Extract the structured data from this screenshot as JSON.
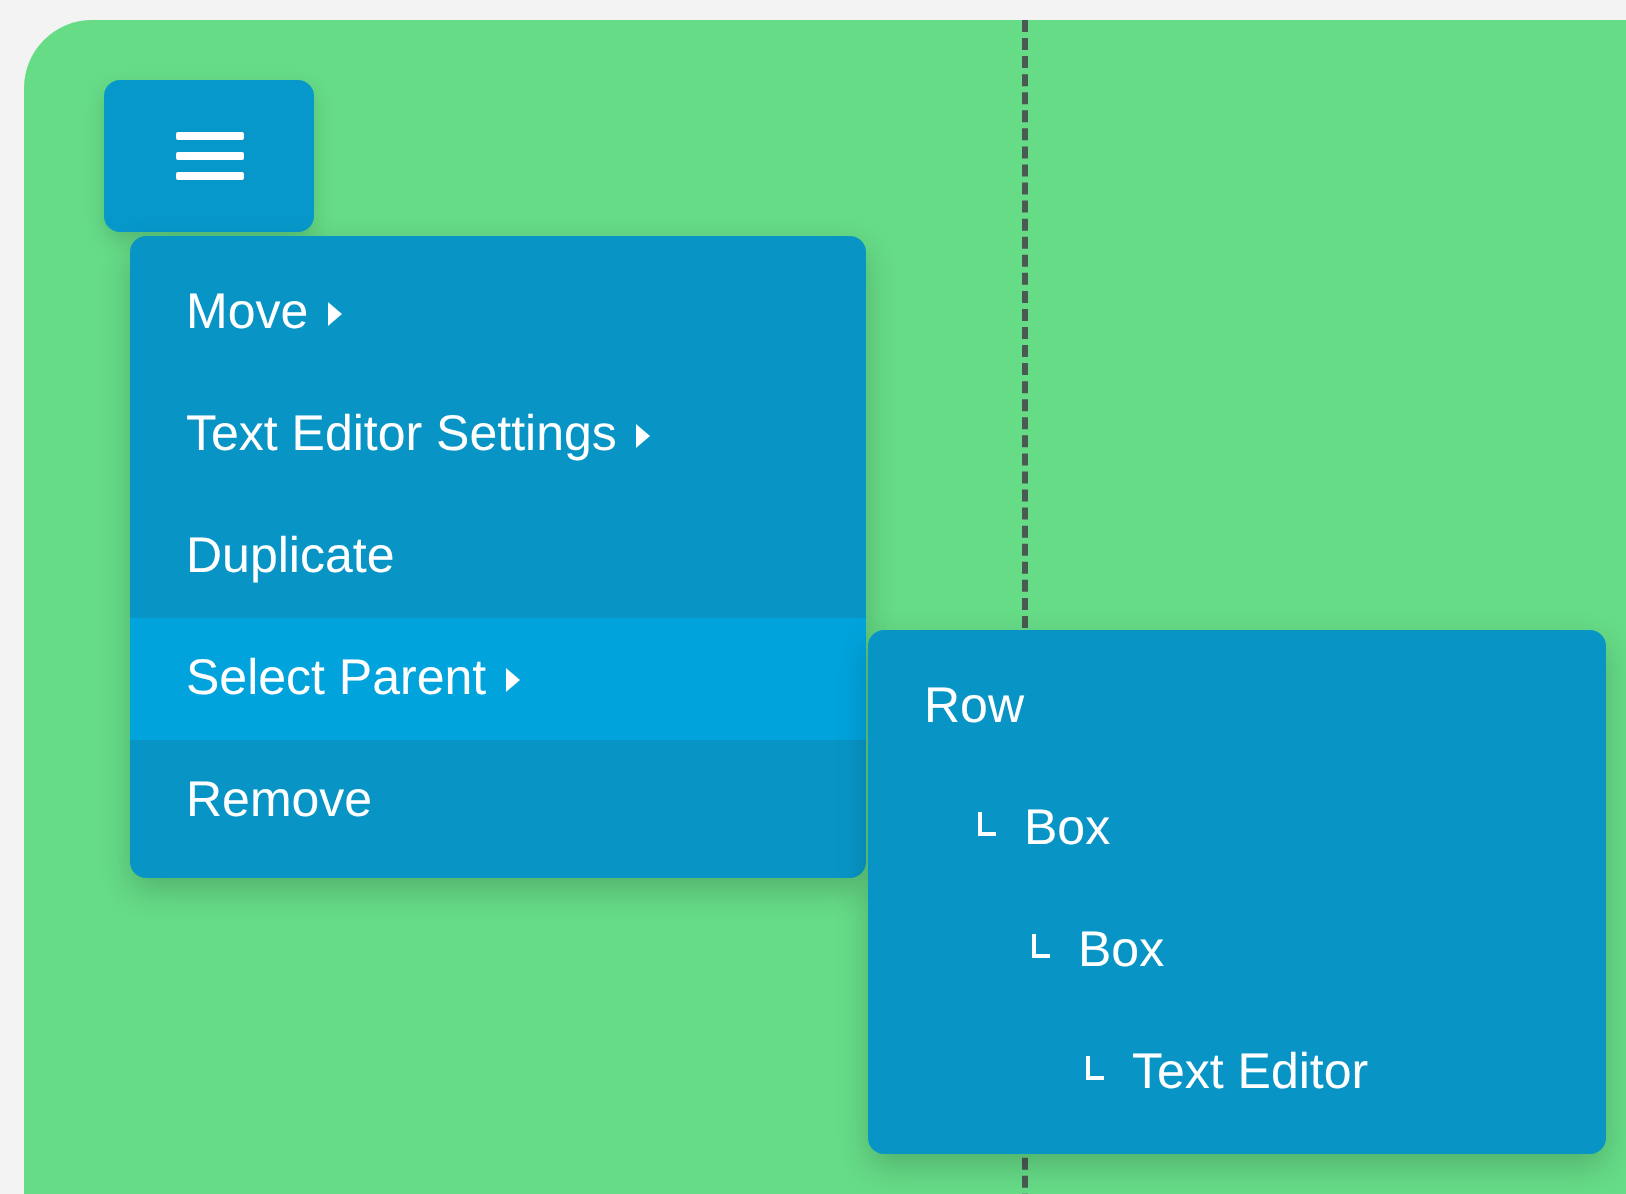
{
  "menu_button": {
    "expanded": true
  },
  "menu": {
    "items": [
      {
        "label": "Move",
        "submenu": true,
        "selected": false
      },
      {
        "label": "Text Editor Settings",
        "submenu": true,
        "selected": false
      },
      {
        "label": "Duplicate",
        "submenu": false,
        "selected": false
      },
      {
        "label": "Select Parent",
        "submenu": true,
        "selected": true
      },
      {
        "label": "Remove",
        "submenu": false,
        "selected": false
      }
    ]
  },
  "parent_menu": {
    "items": [
      {
        "label": "Row",
        "children": [
          {
            "label": "Box",
            "children": [
              {
                "label": "Box",
                "children": [
                  {
                    "label": "Text Editor"
                  }
                ]
              }
            ]
          }
        ]
      }
    ]
  }
}
